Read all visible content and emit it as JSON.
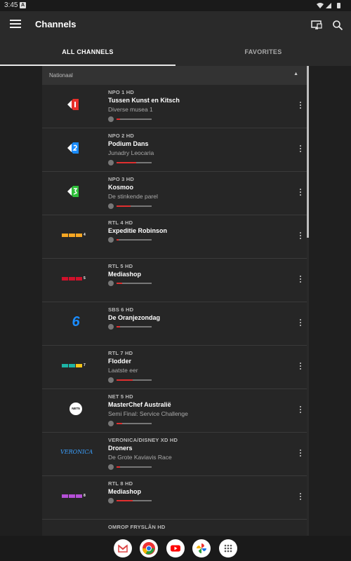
{
  "status": {
    "time": "3:45",
    "notif": "A"
  },
  "appbar": {
    "title": "Channels"
  },
  "tabs": [
    {
      "label": "ALL CHANNELS"
    },
    {
      "label": "FAVORITES"
    }
  ],
  "section": {
    "label": "Nationaal"
  },
  "channels": [
    {
      "name": "NPO 1 HD",
      "program": "Tussen Kunst en Kitsch",
      "subtitle": "Diverse musea 1",
      "progress": 0.1,
      "logo": "npo1-logo"
    },
    {
      "name": "NPO 2 HD",
      "program": "Podium Dans",
      "subtitle": "Junadry Leocaria",
      "progress": 0.55,
      "logo": "npo2-logo"
    },
    {
      "name": "NPO 3 HD",
      "program": "Kosmoo",
      "subtitle": "De stinkende parel",
      "progress": 0.4,
      "logo": "npo3-logo"
    },
    {
      "name": "RTL 4 HD",
      "program": "Expeditie Robinson",
      "subtitle": "",
      "progress": 0.05,
      "logo": "rtl4-logo"
    },
    {
      "name": "RTL 5 HD",
      "program": "Mediashop",
      "subtitle": "",
      "progress": 0.15,
      "logo": "rtl5-logo"
    },
    {
      "name": "SBS 6 HD",
      "program": "De Oranjezondag",
      "subtitle": "",
      "progress": 0.1,
      "logo": "sbs6-logo"
    },
    {
      "name": "RTL 7 HD",
      "program": "Flodder",
      "subtitle": "Laatste eer",
      "progress": 0.45,
      "logo": "rtl7-logo"
    },
    {
      "name": "NET 5 HD",
      "program": "MasterChef Australië",
      "subtitle": "Semi Final: Service Challenge",
      "progress": 0.15,
      "logo": "net5-logo"
    },
    {
      "name": "VERONICA/DISNEY XD HD",
      "program": "Droners",
      "subtitle": "De Grote Kaviavis Race",
      "progress": 0.1,
      "logo": "veronica-logo"
    },
    {
      "name": "RTL 8 HD",
      "program": "Mediashop",
      "subtitle": "",
      "progress": 0.45,
      "logo": "rtl8-logo"
    },
    {
      "name": "OMROP FRYSLÂN HD",
      "program": "",
      "subtitle": "",
      "progress": 0,
      "logo": "omrop-logo"
    }
  ],
  "logo_texts": {
    "rtl4": "4",
    "rtl5": "5",
    "rtl7": "7",
    "rtl8": "8",
    "sbs6": "6",
    "net5": "NET5",
    "veronica": "VERONICA"
  },
  "colors": {
    "accent": "#e03030",
    "background": "#1f1f1f",
    "row": "#262626"
  },
  "dock_apps": [
    "gmail-icon",
    "chrome-icon",
    "youtube-icon",
    "photos-icon",
    "app-drawer-icon"
  ]
}
